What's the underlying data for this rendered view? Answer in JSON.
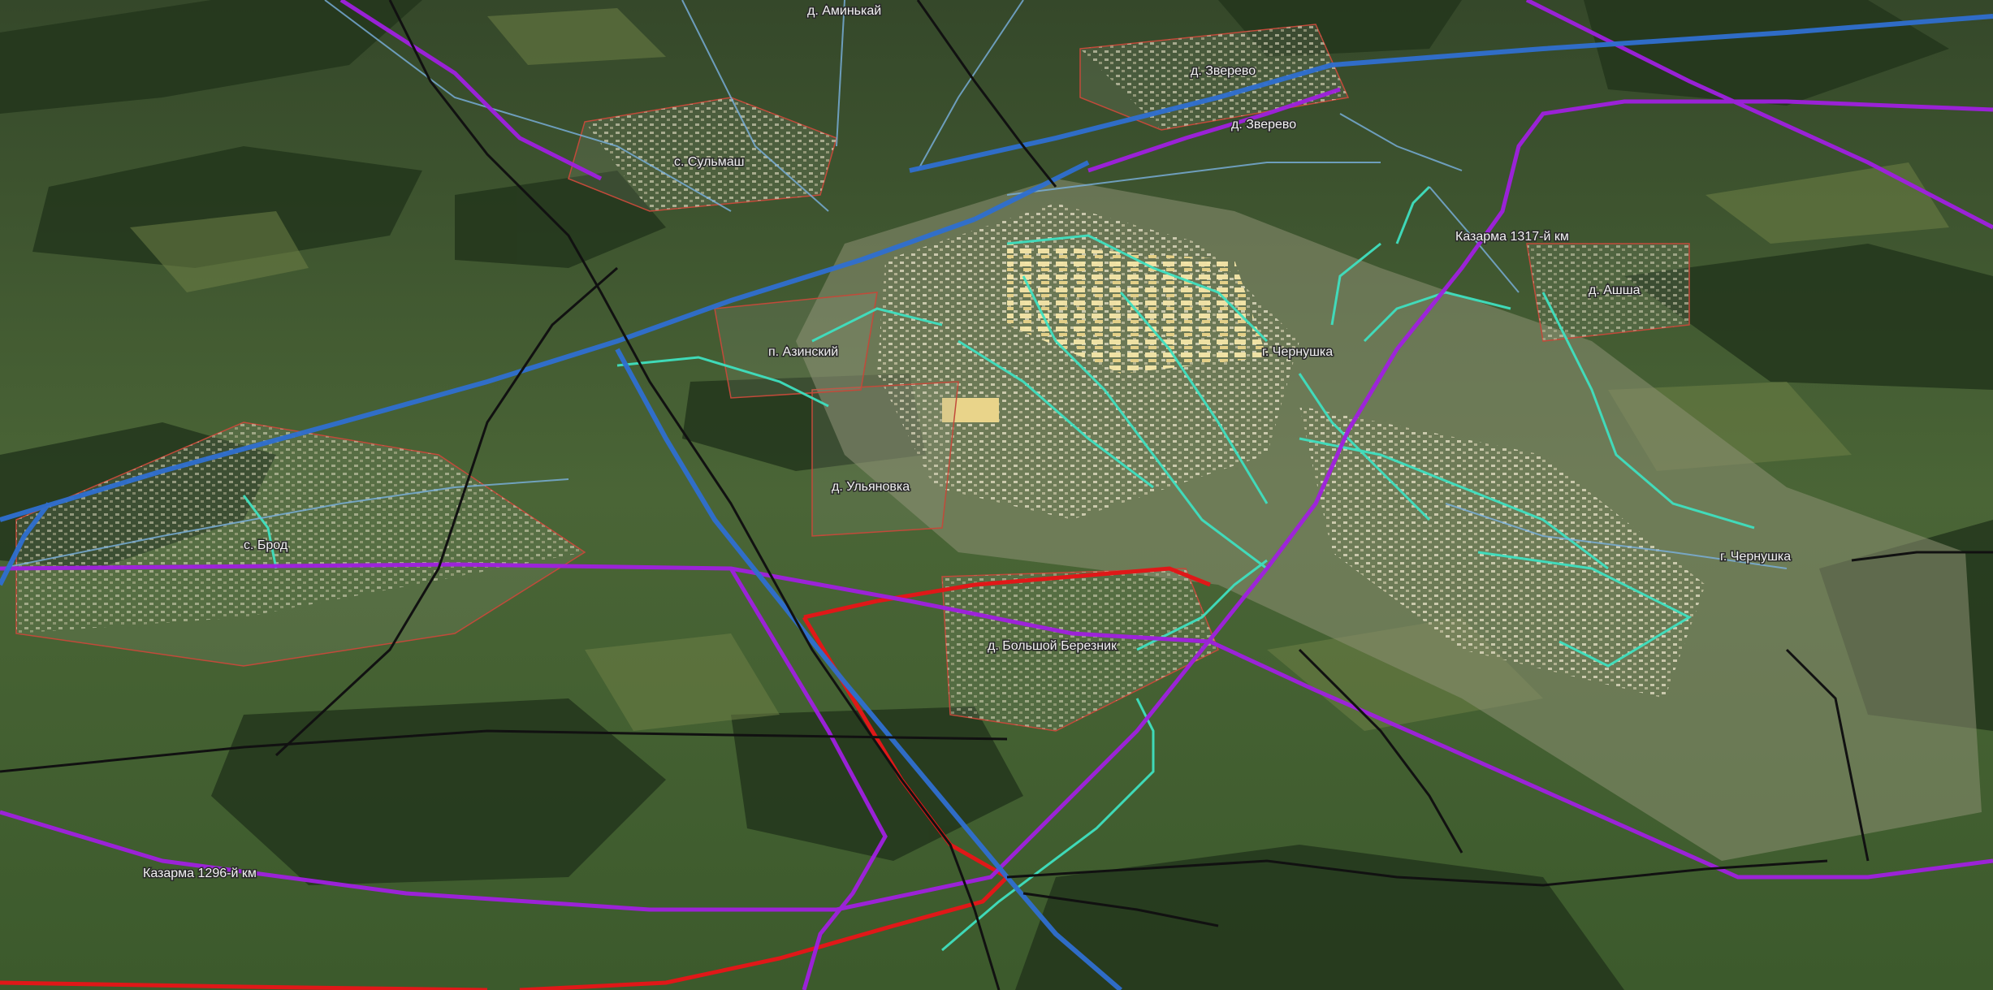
{
  "map": {
    "view": "aerial-oblique",
    "basemap": "satellite",
    "colors": {
      "pipeline_blue": "#2f6fd0",
      "pipeline_violet": "#a020e0",
      "pipeline_red": "#e01818",
      "railway_black": "#111111",
      "utility_cyan": "#3fe0c0",
      "building_yellow": "#f5e6a8",
      "settlement_boundary": "#c24a3a"
    },
    "labels": {
      "aminkay": "д. Аминькай",
      "zverevo_1": "д. Зверево",
      "zverevo_2": "д. Зверево",
      "sulmash": "с. Сульмаш",
      "kazarma_1317": "Казарма 1317-й км",
      "ashsha": "д. Ашша",
      "azinsky": "п. Азинский",
      "chernushka_city": "г. Чернушка",
      "ulyanovka": "д. Ульяновка",
      "brod": "с. Брод",
      "chernushka_east": "г. Чернушка",
      "bolshoy_bereznik": "д. Большой Березник",
      "kazarma_1296": "Казарма 1296-й км"
    }
  }
}
